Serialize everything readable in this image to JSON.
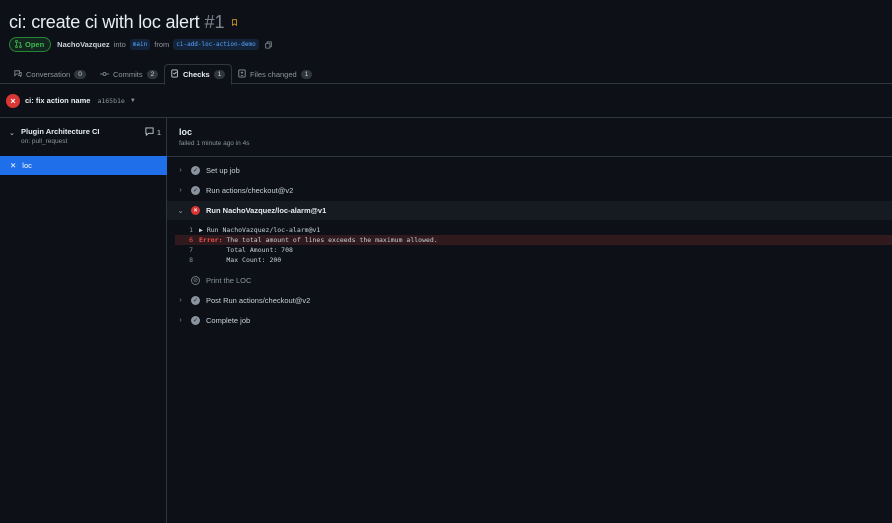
{
  "pr": {
    "title": "ci: create ci with loc alert",
    "number": "#1",
    "state": "Open",
    "author": "NachoVazquez",
    "into_text": "into",
    "base_branch": "main",
    "from_text": "from",
    "head_branch": "ci-add-loc-action-demo"
  },
  "tabs": [
    {
      "label": "Conversation",
      "count": "0"
    },
    {
      "label": "Commits",
      "count": "2"
    },
    {
      "label": "Checks",
      "count": "1"
    },
    {
      "label": "Files changed",
      "count": "1"
    }
  ],
  "commit": {
    "message": "ci: fix action name",
    "sha": "a165b1e"
  },
  "workflow": {
    "name": "Plugin Architecture CI",
    "trigger": "on: pull_request",
    "comment_count": "1",
    "job": "loc"
  },
  "job": {
    "name": "loc",
    "status": "failed 1 minute ago in 4s",
    "steps": [
      {
        "name": "Set up job"
      },
      {
        "name": "Run actions/checkout@v2"
      },
      {
        "name": "Run NachoVazquez/loc-alarm@v1"
      },
      {
        "name": "Print the LOC"
      },
      {
        "name": "Post Run actions/checkout@v2"
      },
      {
        "name": "Complete job"
      }
    ],
    "log": [
      {
        "line": "1",
        "text": "▶ Run NachoVazquez/loc-alarm@v1"
      },
      {
        "line": "6",
        "label": "Error:",
        "text": " The total amount of lines exceeds the maximum allowed."
      },
      {
        "line": "7",
        "text": "       Total Amount: 708"
      },
      {
        "line": "8",
        "text": "       Max Count: 200"
      }
    ]
  },
  "colors": {
    "background": "#0d1117",
    "accent": "#1f6feb",
    "success": "#3fb950",
    "failure": "#da3633"
  }
}
